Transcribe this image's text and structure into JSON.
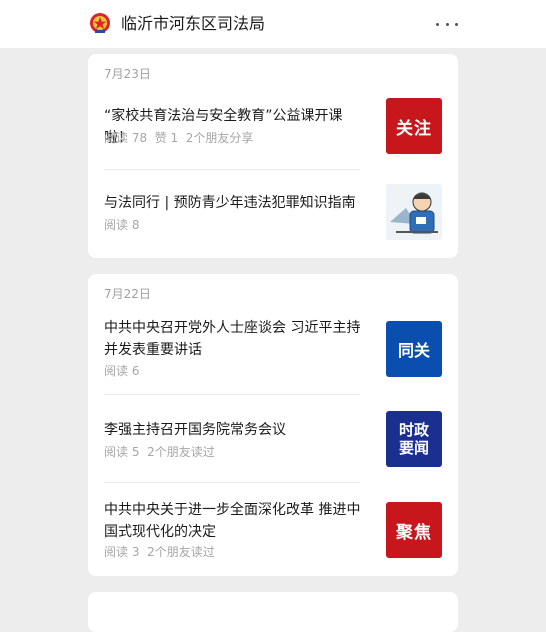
{
  "header": {
    "title": "临沂市河东区司法局",
    "logo_icon": "police-emblem-icon",
    "more_icon": "more-dots-icon"
  },
  "cards": [
    {
      "date": "7月23日",
      "items": [
        {
          "title": "“家校共育法治与安全教育”公益课开课啦！",
          "meta": "阅读 78  赞 1  2个朋友分享",
          "thumb_text": "关注"
        },
        {
          "title": "与法同行 | 预防青少年违法犯罪知识指南",
          "meta": "阅读 8",
          "thumb_text": ""
        }
      ]
    },
    {
      "date": "7月22日",
      "items": [
        {
          "title": "中共中央召开党外人士座谈会 习近平主持并发表重要讲话",
          "meta": "阅读 6",
          "thumb_text": "同关"
        },
        {
          "title": "李强主持召开国务院常务会议",
          "meta": "阅读 5  2个朋友读过",
          "thumb_text_1": "时政",
          "thumb_text_2": "要闻"
        },
        {
          "title": "中共中央关于进一步全面深化改革 推进中国式现代化的决定",
          "meta": "阅读 3  2个朋友读过",
          "thumb_text": "聚焦"
        }
      ]
    }
  ],
  "colors": {
    "background": "#ededed",
    "card": "#ffffff",
    "accent_red": "#c8161d",
    "accent_blue": "#0a4fb0",
    "accent_navy": "#1a2f8e"
  }
}
